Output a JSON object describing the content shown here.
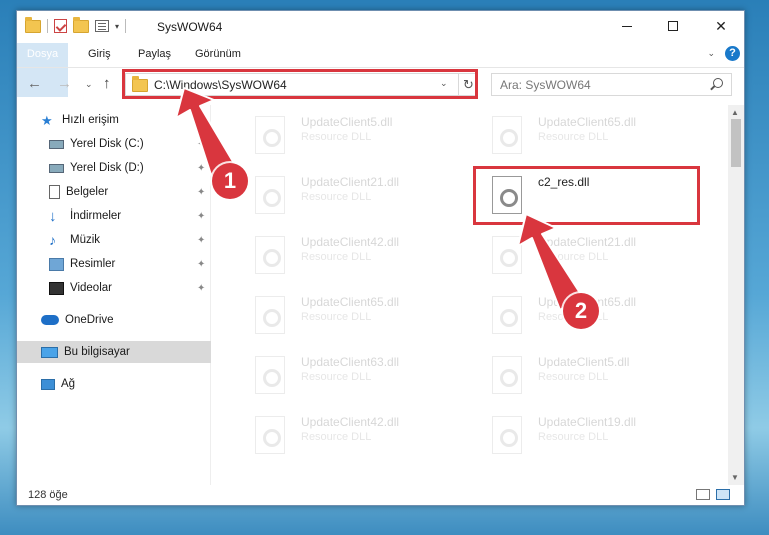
{
  "window": {
    "title": "SysWOW64",
    "minimize_glyph": "",
    "maximize_glyph": "",
    "close_glyph": "✕"
  },
  "ribbon": {
    "tabs": [
      "Dosya",
      "Giriş",
      "Paylaş",
      "Görünüm"
    ],
    "help_glyph": "?"
  },
  "nav": {
    "back_glyph": "←",
    "forward_glyph": "→",
    "recent_glyph": "⌄",
    "up_glyph": "↑",
    "address": "C:\\Windows\\SysWOW64",
    "refresh_glyph": "↻",
    "dropdown_glyph": "⌄",
    "search_placeholder": "Ara: SysWOW64"
  },
  "sidebar": {
    "items": [
      {
        "label": "Hızlı erişim",
        "icon": "star-icon",
        "pinned": false
      },
      {
        "label": "Yerel Disk (C:)",
        "icon": "drive-icon",
        "pinned": true
      },
      {
        "label": "Yerel Disk (D:)",
        "icon": "drive-icon",
        "pinned": true
      },
      {
        "label": "Belgeler",
        "icon": "document-icon",
        "pinned": true
      },
      {
        "label": "İndirmeler",
        "icon": "download-icon",
        "pinned": true
      },
      {
        "label": "Müzik",
        "icon": "music-icon",
        "pinned": true
      },
      {
        "label": "Resimler",
        "icon": "pictures-icon",
        "pinned": true
      },
      {
        "label": "Videolar",
        "icon": "video-icon",
        "pinned": true
      },
      {
        "label": "OneDrive",
        "icon": "cloud-icon",
        "pinned": false
      },
      {
        "label": "Bu bilgisayar",
        "icon": "computer-icon",
        "pinned": false,
        "selected": true
      },
      {
        "label": "Ağ",
        "icon": "network-icon",
        "pinned": false
      }
    ],
    "pin_glyph": "📌"
  },
  "files": [
    {
      "name": "UpdateClient5.dll",
      "type": "Resource DLL",
      "highlighted": false
    },
    {
      "name": "UpdateClient65.dll",
      "type": "Resource DLL",
      "highlighted": false
    },
    {
      "name": "UpdateClient21.dll",
      "type": "Resource DLL",
      "highlighted": false
    },
    {
      "name": "c2_res.dll",
      "type": "",
      "highlighted": true
    },
    {
      "name": "UpdateClient42.dll",
      "type": "Resource DLL",
      "highlighted": false
    },
    {
      "name": "UpdateClient21.dll",
      "type": "Resource DLL",
      "highlighted": false
    },
    {
      "name": "UpdateClient65.dll",
      "type": "Resource DLL",
      "highlighted": false
    },
    {
      "name": "UpdateClient65.dll",
      "type": "Resource DLL",
      "highlighted": false
    },
    {
      "name": "UpdateClient63.dll",
      "type": "Resource DLL",
      "highlighted": false
    },
    {
      "name": "UpdateClient5.dll",
      "type": "Resource DLL",
      "highlighted": false
    },
    {
      "name": "UpdateClient42.dll",
      "type": "Resource DLL",
      "highlighted": false
    },
    {
      "name": "UpdateClient19.dll",
      "type": "Resource DLL",
      "highlighted": false
    }
  ],
  "status": {
    "item_count": "128 öğe"
  },
  "callouts": {
    "one": "1",
    "two": "2"
  },
  "colors": {
    "accent": "#1979ca",
    "highlight_red": "#d9363e",
    "selected_bg": "#d9d9d9"
  }
}
